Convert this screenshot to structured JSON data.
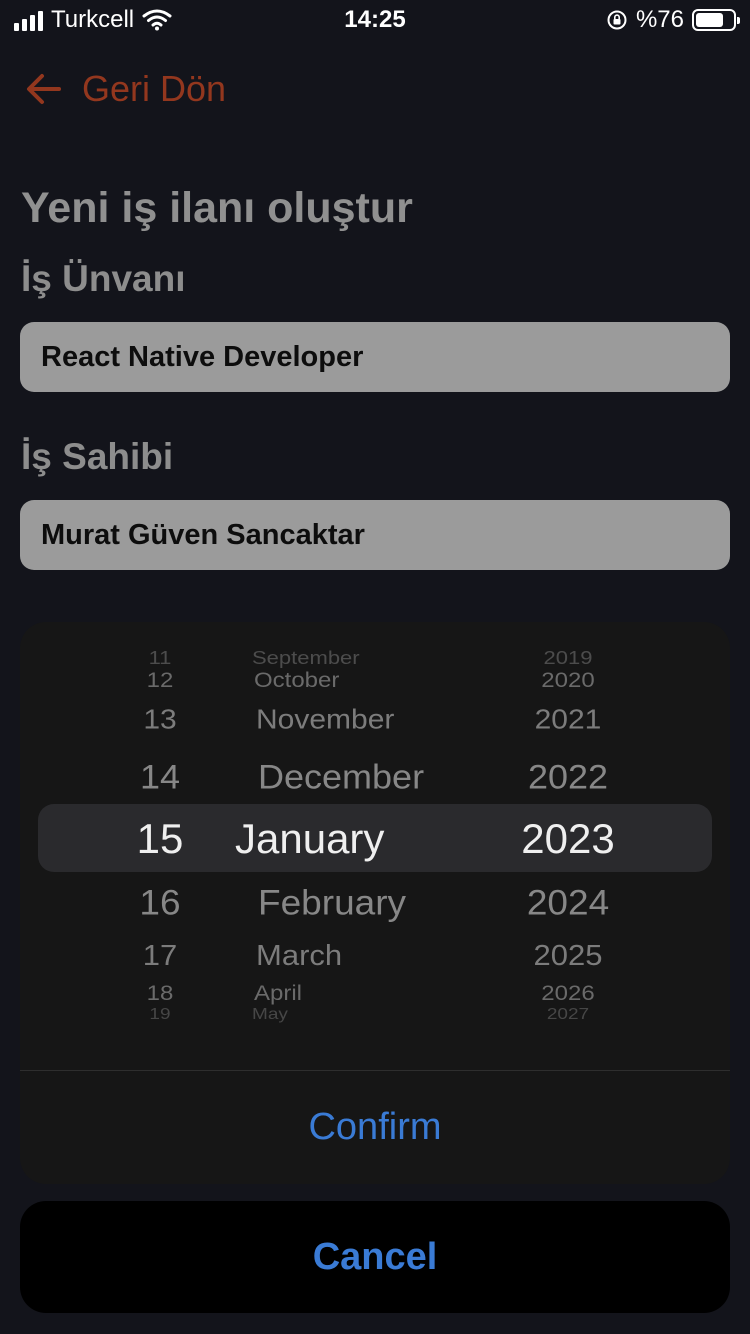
{
  "status_bar": {
    "carrier": "Turkcell",
    "time": "14:25",
    "battery_text": "%76",
    "battery_level": 0.76,
    "icons": [
      "signal-icon",
      "wifi-icon",
      "orientation-lock-icon",
      "battery-icon"
    ]
  },
  "nav": {
    "back_label": "Geri Dön",
    "back_icon": "arrow-left-icon",
    "accent_color": "#93371e"
  },
  "form": {
    "title": "Yeni iş ilanı oluştur",
    "job_title_label": "İş Ünvanı",
    "job_title_value": "React Native Developer",
    "owner_label": "İş Sahibi",
    "owner_value": "Murat Güven Sancaktar"
  },
  "picker": {
    "day_column": [
      "11",
      "12",
      "13",
      "14",
      "15",
      "16",
      "17",
      "18",
      "19"
    ],
    "month_column": [
      "September",
      "October",
      "November",
      "December",
      "January",
      "February",
      "March",
      "April",
      "May"
    ],
    "year_column": [
      "2019",
      "2020",
      "2021",
      "2022",
      "2023",
      "2024",
      "2025",
      "2026",
      "2027"
    ],
    "selected": {
      "day": "15",
      "month": "January",
      "year": "2023"
    },
    "confirm_label": "Confirm",
    "cancel_label": "Cancel",
    "button_color": "#3a7bd5"
  }
}
